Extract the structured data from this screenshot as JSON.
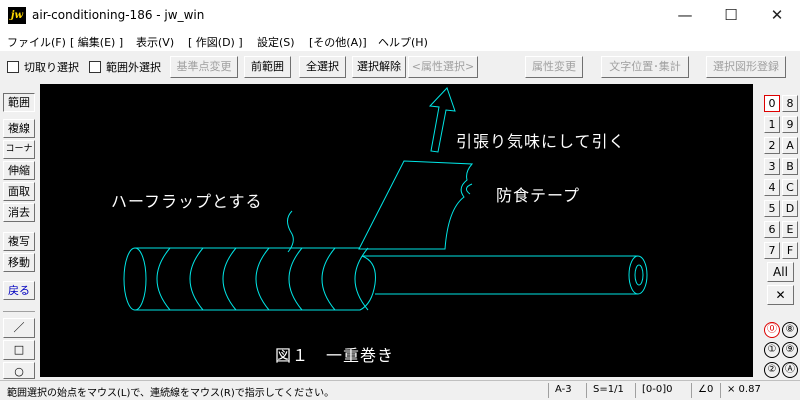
{
  "window": {
    "app_icon_text": "jw",
    "title": "air-conditioning-186 - jw_win",
    "min_glyph": "—",
    "max_glyph": "☐",
    "close_glyph": "✕"
  },
  "menu": [
    "ファイル(F)",
    "[ 編集(E) ]",
    "表示(V)",
    "[ 作図(D) ]",
    "設定(S)",
    "[その他(A)]",
    "ヘルプ(H)"
  ],
  "toolbar": {
    "check1_label": "切取り選択",
    "check2_label": "範囲外選択",
    "btn_base_point": "基準点変更",
    "btn_prev_range": "前範囲",
    "btn_select_all": "全選択",
    "btn_clear_selection": "選択解除",
    "btn_attr_select": "<属性選択>",
    "btn_attr_change": "属性変更",
    "btn_text_pos": "文字位置･集計",
    "btn_register_shape": "選択図形登録"
  },
  "toolbox": [
    "範囲",
    "複線",
    "コーナー",
    "伸縮",
    "面取",
    "消去",
    "複写",
    "移動",
    "戻る"
  ],
  "toolbox_icons": {
    "line": "／",
    "rect": "□",
    "circle": "○"
  },
  "canvas": {
    "background": "#000000",
    "drawing_color": "#00e5e5",
    "label_pull": "引張り気味にして引く",
    "label_half_lap": "ハーフラップとする",
    "label_tape": "防食テープ",
    "caption": "図１　一重巻き"
  },
  "layers": {
    "numbers": [
      "0",
      "1",
      "2",
      "3",
      "4",
      "5",
      "6",
      "7"
    ],
    "letters": [
      "8",
      "9",
      "A",
      "B",
      "C",
      "D",
      "E",
      "F"
    ],
    "active": "0",
    "all_label": "All",
    "cross_glyph": "✕"
  },
  "groups": {
    "left": [
      "⓪",
      "①",
      "②"
    ],
    "right": [
      "⑧",
      "⑨",
      "Ⓐ"
    ]
  },
  "status": {
    "message": "範囲選択の始点をマウス(L)で、連続線をマウス(R)で指示してください。",
    "paper": "A-3",
    "scale": "S=1/1",
    "layer": "[0-0]0",
    "angle": "∠0",
    "factor": "× 0.87"
  }
}
